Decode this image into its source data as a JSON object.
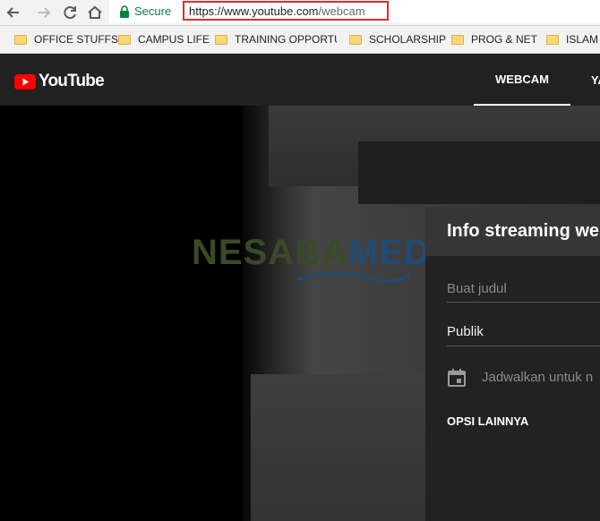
{
  "browser": {
    "secure_label": "Secure",
    "url_host": "https://www.youtube.com",
    "url_path": "/webcam",
    "bookmarks": [
      {
        "label": "OFFICE STUFFS"
      },
      {
        "label": "CAMPUS LIFE"
      },
      {
        "label": "TRAINING OPPORTUI"
      },
      {
        "label": "SCHOLARSHIP"
      },
      {
        "label": "PROG & NET"
      },
      {
        "label": "ISLAM"
      }
    ],
    "icons": [
      "back-icon",
      "forward-icon",
      "reload-icon",
      "home-icon",
      "lock-icon",
      "folder-icon"
    ]
  },
  "youtube": {
    "logo_text": "YouTube",
    "tabs": [
      {
        "label": "WEBCAM",
        "active": true
      },
      {
        "label": "YA",
        "active": false
      }
    ]
  },
  "watermark": {
    "part1": "NESABA",
    "part2": "MEDIA"
  },
  "panel": {
    "title": "Info streaming web",
    "title_placeholder": "Buat judul",
    "privacy_value": "Publik",
    "schedule_label": "Jadwalkan untuk n",
    "more_options": "OPSI LAINNYA"
  },
  "colors": {
    "secure_green": "#0b8043",
    "highlight_red": "#e32b2b",
    "youtube_red": "#ff0000",
    "header_bg": "#212121",
    "panel_bg": "#222222",
    "panel_header_bg": "#363636"
  }
}
